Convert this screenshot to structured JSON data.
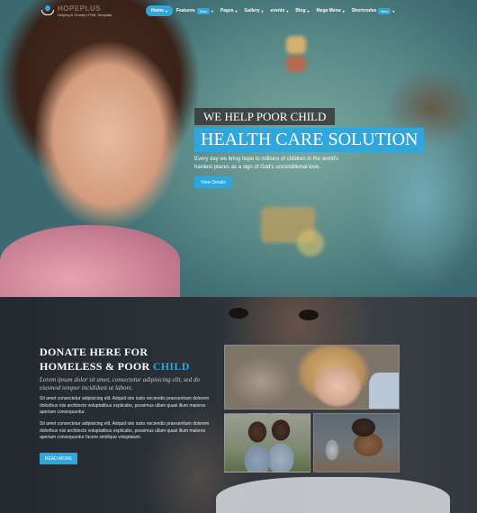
{
  "brand": {
    "logo_title": "HOPEPLUS",
    "logo_sub": "Helping & Charity HTML Template",
    "accent_color": "#2fa7dc"
  },
  "nav": {
    "items": [
      {
        "label": "Home",
        "caret": "▾",
        "active": true
      },
      {
        "label": "Features",
        "badge": "New",
        "caret": "▾"
      },
      {
        "label": "Pages",
        "caret": "▾"
      },
      {
        "label": "Gallery",
        "caret": "▾"
      },
      {
        "label": "events",
        "caret": "▾"
      },
      {
        "label": "Blog",
        "caret": "▾"
      },
      {
        "label": "Mega Menu",
        "caret": "▾"
      },
      {
        "label": "Shortcodes",
        "badge": "New",
        "caret": "▾"
      }
    ]
  },
  "hero": {
    "kicker": "WE HELP POOR CHILD",
    "title": "HEALTH CARE SOLUTION",
    "description": "Every day we bring hope to millions of children in the world's hardest places as a sign of God's unconditional love.",
    "button": "View Details"
  },
  "donate": {
    "heading_line1": "DONATE HERE FOR",
    "heading_line2_prefix": "HOMELESS & POOR",
    "heading_line2_highlight": "CHILD",
    "lead": "Lorem ipsum dolor sit amet, consectetur adipisicing elit, sed do eiusmod tempor incididunt ut labore.",
    "paragraph1": "Sit amet consectetur adipisicing elit. Adquid iste iusto reiciendis praesentium dolorem doloribus nisi architecto voluptatibus explicabo, possimus ullam quasi illum maiores aperiam consequuntur.",
    "paragraph2": "Sit amet consectetur adipisicing elit. Adquid iste iusto reiciendis praesentium dolorem doloribus nisi architecto voluptatibus explicabo, possimus ullam quasi illum maiores aperiam consequuntur facere similique voluptatum.",
    "button": "READ MORE"
  }
}
